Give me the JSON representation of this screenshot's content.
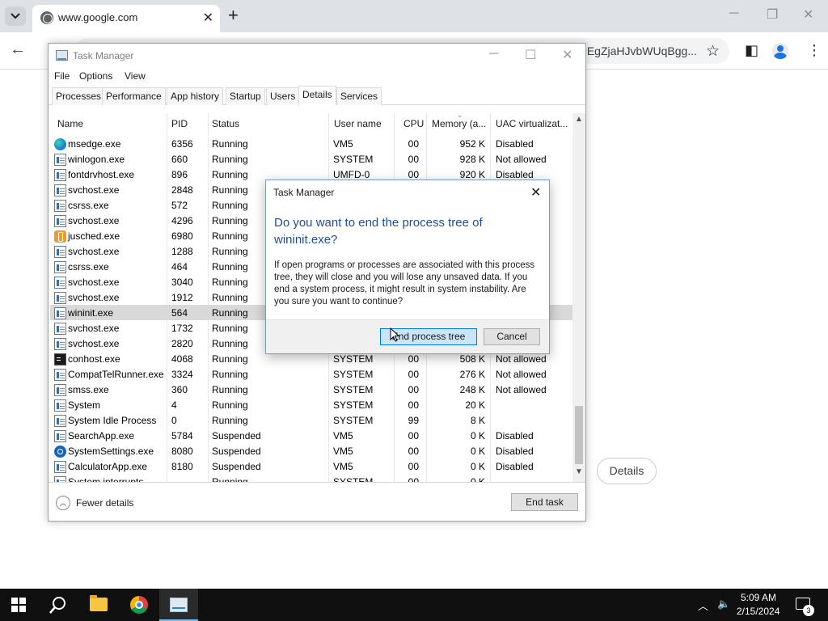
{
  "browser": {
    "tab_title": "www.google.com",
    "new_tab_glyph": "+",
    "omnibox_tail": "=EgZjaHJvbWUqBgg...",
    "details_button": "Details"
  },
  "task_manager": {
    "title": "Task Manager",
    "menu": [
      "File",
      "Options",
      "View"
    ],
    "tabs": [
      "Processes",
      "Performance",
      "App history",
      "Startup",
      "Users",
      "Details",
      "Services"
    ],
    "active_tab": "Details",
    "columns": [
      "Name",
      "PID",
      "Status",
      "User name",
      "CPU",
      "Memory (a...",
      "UAC virtualizat..."
    ],
    "rows": [
      {
        "name": "msedge.exe",
        "pid": "6356",
        "status": "Running",
        "user": "VM5",
        "cpu": "00",
        "mem": "952 K",
        "uac": "Disabled",
        "icon": "edge-icon"
      },
      {
        "name": "winlogon.exe",
        "pid": "660",
        "status": "Running",
        "user": "SYSTEM",
        "cpu": "00",
        "mem": "928 K",
        "uac": "Not allowed",
        "icon": "process-icon"
      },
      {
        "name": "fontdrvhost.exe",
        "pid": "896",
        "status": "Running",
        "user": "UMFD-0",
        "cpu": "00",
        "mem": "920 K",
        "uac": "Disabled",
        "icon": "process-icon"
      },
      {
        "name": "svchost.exe",
        "pid": "2848",
        "status": "Running",
        "user": "",
        "cpu": "",
        "mem": "",
        "uac": "",
        "icon": "process-icon"
      },
      {
        "name": "csrss.exe",
        "pid": "572",
        "status": "Running",
        "user": "",
        "cpu": "",
        "mem": "",
        "uac": "",
        "icon": "process-icon"
      },
      {
        "name": "svchost.exe",
        "pid": "4296",
        "status": "Running",
        "user": "",
        "cpu": "",
        "mem": "",
        "uac": "",
        "icon": "process-icon"
      },
      {
        "name": "jusched.exe",
        "pid": "6980",
        "status": "Running",
        "user": "",
        "cpu": "",
        "mem": "",
        "uac": "",
        "icon": "java-icon"
      },
      {
        "name": "svchost.exe",
        "pid": "1288",
        "status": "Running",
        "user": "",
        "cpu": "",
        "mem": "",
        "uac": "",
        "icon": "process-icon"
      },
      {
        "name": "csrss.exe",
        "pid": "464",
        "status": "Running",
        "user": "",
        "cpu": "",
        "mem": "",
        "uac": "",
        "icon": "process-icon"
      },
      {
        "name": "svchost.exe",
        "pid": "3040",
        "status": "Running",
        "user": "",
        "cpu": "",
        "mem": "",
        "uac": "",
        "icon": "process-icon"
      },
      {
        "name": "svchost.exe",
        "pid": "1912",
        "status": "Running",
        "user": "",
        "cpu": "",
        "mem": "",
        "uac": "",
        "icon": "process-icon"
      },
      {
        "name": "wininit.exe",
        "pid": "564",
        "status": "Running",
        "user": "",
        "cpu": "",
        "mem": "",
        "uac": "",
        "icon": "process-icon",
        "selected": true
      },
      {
        "name": "svchost.exe",
        "pid": "1732",
        "status": "Running",
        "user": "",
        "cpu": "",
        "mem": "",
        "uac": "",
        "icon": "process-icon"
      },
      {
        "name": "svchost.exe",
        "pid": "2820",
        "status": "Running",
        "user": "",
        "cpu": "",
        "mem": "",
        "uac": "",
        "icon": "process-icon"
      },
      {
        "name": "conhost.exe",
        "pid": "4068",
        "status": "Running",
        "user": "SYSTEM",
        "cpu": "00",
        "mem": "508 K",
        "uac": "Not allowed",
        "icon": "console-icon"
      },
      {
        "name": "CompatTelRunner.exe",
        "pid": "3324",
        "status": "Running",
        "user": "SYSTEM",
        "cpu": "00",
        "mem": "276 K",
        "uac": "Not allowed",
        "icon": "process-icon"
      },
      {
        "name": "smss.exe",
        "pid": "360",
        "status": "Running",
        "user": "SYSTEM",
        "cpu": "00",
        "mem": "248 K",
        "uac": "Not allowed",
        "icon": "process-icon"
      },
      {
        "name": "System",
        "pid": "4",
        "status": "Running",
        "user": "SYSTEM",
        "cpu": "00",
        "mem": "20 K",
        "uac": "",
        "icon": "process-icon"
      },
      {
        "name": "System Idle Process",
        "pid": "0",
        "status": "Running",
        "user": "SYSTEM",
        "cpu": "99",
        "mem": "8 K",
        "uac": "",
        "icon": "process-icon"
      },
      {
        "name": "SearchApp.exe",
        "pid": "5784",
        "status": "Suspended",
        "user": "VM5",
        "cpu": "00",
        "mem": "0 K",
        "uac": "Disabled",
        "icon": "process-icon"
      },
      {
        "name": "SystemSettings.exe",
        "pid": "8080",
        "status": "Suspended",
        "user": "VM5",
        "cpu": "00",
        "mem": "0 K",
        "uac": "Disabled",
        "icon": "gear-icon"
      },
      {
        "name": "CalculatorApp.exe",
        "pid": "8180",
        "status": "Suspended",
        "user": "VM5",
        "cpu": "00",
        "mem": "0 K",
        "uac": "Disabled",
        "icon": "process-icon"
      },
      {
        "name": "System interrupts",
        "pid": "-",
        "status": "Running",
        "user": "SYSTEM",
        "cpu": "00",
        "mem": "0 K",
        "uac": "",
        "icon": "process-icon"
      }
    ],
    "fewer_details": "Fewer details",
    "end_task": "End task"
  },
  "dialog": {
    "title": "Task Manager",
    "heading": "Do you want to end the process tree of wininit.exe?",
    "body": "If open programs or processes are associated with this process tree, they will close and you will lose any unsaved data. If you end a system process, it might result in system instability. Are you sure you want to continue?",
    "confirm_button": "End process tree",
    "cancel_button": "Cancel"
  },
  "taskbar": {
    "time": "5:09 AM",
    "date": "2/15/2024",
    "notification_count": "3"
  }
}
